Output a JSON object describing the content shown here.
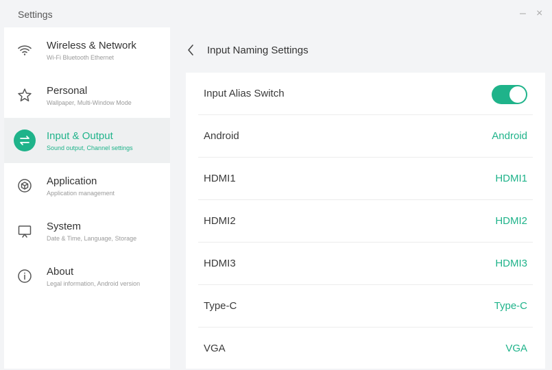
{
  "window": {
    "title": "Settings",
    "minimize_glyph": "–",
    "close_glyph": "×"
  },
  "sidebar": {
    "items": [
      {
        "label": "Wireless & Network",
        "sub": "Wi-Fi Bluetooth Ethernet",
        "icon": "wifi-icon",
        "active": false
      },
      {
        "label": "Personal",
        "sub": "Wallpaper, Multi-Window Mode",
        "icon": "star-icon",
        "active": false
      },
      {
        "label": "Input & Output",
        "sub": "Sound output, Channel settings",
        "icon": "swap-arrows-icon",
        "active": true
      },
      {
        "label": "Application",
        "sub": "Application management",
        "icon": "cube-icon",
        "active": false
      },
      {
        "label": "System",
        "sub": "Date & Time, Language, Storage",
        "icon": "monitor-icon",
        "active": false
      },
      {
        "label": "About",
        "sub": "Legal information, Android version",
        "icon": "info-icon",
        "active": false
      }
    ]
  },
  "main": {
    "title": "Input Naming Settings",
    "back_icon": "chevron-left-icon",
    "switch": {
      "label": "Input Alias Switch",
      "on": true
    },
    "inputs": [
      {
        "label": "Android",
        "value": "Android"
      },
      {
        "label": "HDMI1",
        "value": "HDMI1"
      },
      {
        "label": "HDMI2",
        "value": "HDMI2"
      },
      {
        "label": "HDMI3",
        "value": "HDMI3"
      },
      {
        "label": "Type-C",
        "value": "Type-C"
      },
      {
        "label": "VGA",
        "value": "VGA"
      }
    ]
  },
  "colors": {
    "accent": "#1fb38a",
    "background": "#f3f4f6",
    "panel": "#ffffff"
  }
}
